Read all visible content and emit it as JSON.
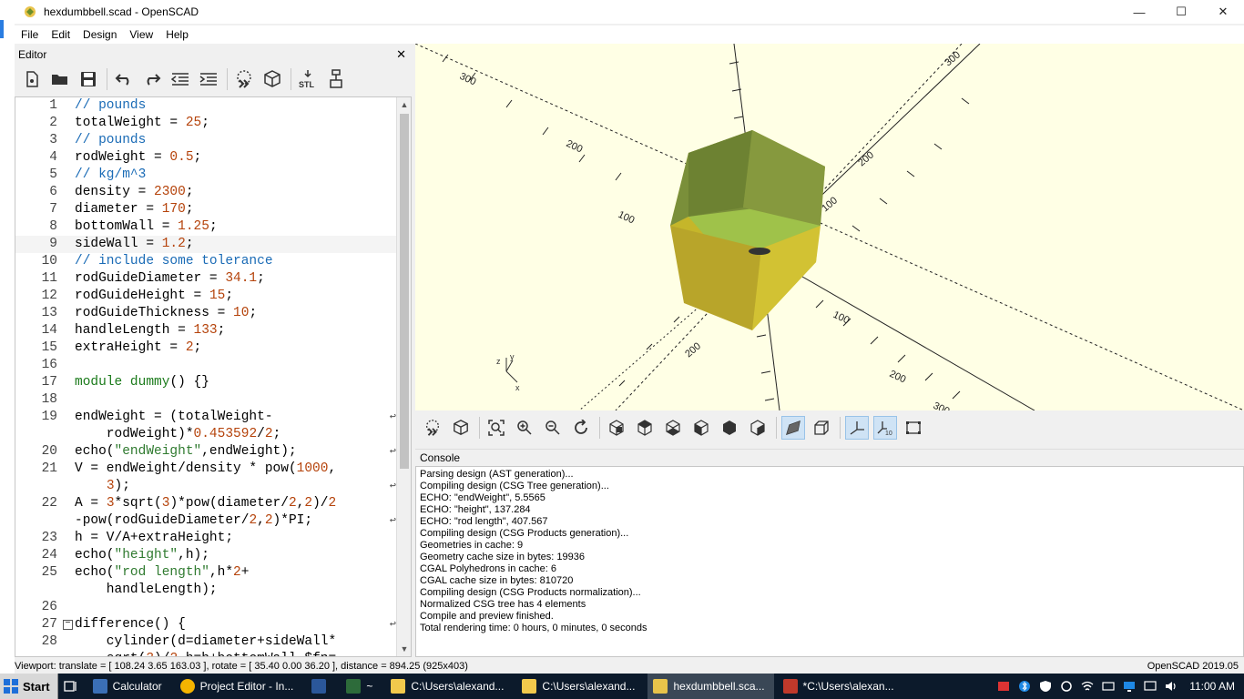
{
  "window": {
    "title": "hexdumbbell.scad - OpenSCAD",
    "controls": {
      "minimize": "—",
      "maximize": "☐",
      "close": "✕"
    }
  },
  "menu": [
    "File",
    "Edit",
    "Design",
    "View",
    "Help"
  ],
  "editor": {
    "title": "Editor",
    "close": "✕",
    "toolbar": [
      "new-icon",
      "open-icon",
      "save-icon",
      "undo-icon",
      "redo-icon",
      "unindent-icon",
      "indent-icon",
      "preview-icon",
      "render-icon",
      "export-stl-icon",
      "send-to-printer-icon"
    ],
    "lines": [
      {
        "n": "1",
        "text": "// pounds"
      },
      {
        "n": "2",
        "text": "totalWeight = 25;"
      },
      {
        "n": "3",
        "text": "// pounds"
      },
      {
        "n": "4",
        "text": "rodWeight = 0.5;"
      },
      {
        "n": "5",
        "text": "// kg/m^3"
      },
      {
        "n": "6",
        "text": "density = 2300;"
      },
      {
        "n": "7",
        "text": "diameter = 170;"
      },
      {
        "n": "8",
        "text": "bottomWall = 1.25;"
      },
      {
        "n": "9",
        "text": "sideWall = 1.2;"
      },
      {
        "n": "10",
        "text": "// include some tolerance"
      },
      {
        "n": "11",
        "text": "rodGuideDiameter = 34.1;"
      },
      {
        "n": "12",
        "text": "rodGuideHeight = 15;"
      },
      {
        "n": "13",
        "text": "rodGuideThickness = 10;"
      },
      {
        "n": "14",
        "text": "handleLength = 133;"
      },
      {
        "n": "15",
        "text": "extraHeight = 2;"
      },
      {
        "n": "16",
        "text": ""
      },
      {
        "n": "17",
        "text": "module dummy() {}"
      },
      {
        "n": "18",
        "text": ""
      },
      {
        "n": "19",
        "text": "endWeight = (totalWeight-"
      },
      {
        "n": "",
        "text": "    rodWeight)*0.453592/2;"
      },
      {
        "n": "20",
        "text": "echo(\"endWeight\",endWeight);"
      },
      {
        "n": "21",
        "text": "V = endWeight/density * pow(1000,"
      },
      {
        "n": "",
        "text": "    3);"
      },
      {
        "n": "22",
        "text": "A = 3*sqrt(3)*pow(diameter/2,2)/2"
      },
      {
        "n": "",
        "text": "-pow(rodGuideDiameter/2,2)*PI;"
      },
      {
        "n": "23",
        "text": "h = V/A+extraHeight;"
      },
      {
        "n": "24",
        "text": "echo(\"height\",h);"
      },
      {
        "n": "25",
        "text": "echo(\"rod length\",h*2+"
      },
      {
        "n": "",
        "text": "    handleLength);"
      },
      {
        "n": "26",
        "text": ""
      },
      {
        "n": "27",
        "text": "difference() {"
      },
      {
        "n": "28",
        "text": "    cylinder(d=diameter+sideWall*"
      },
      {
        "n": "",
        "text": "    sqrt(3)/2,h=h+bottomWall,$fn="
      }
    ]
  },
  "viewport": {
    "axis_ticks": [
      "300",
      "200",
      "100",
      "200",
      "100",
      "300",
      "200",
      "100",
      "200",
      "300"
    ],
    "colors": {
      "background": "#ffffe5",
      "shell_top": "#7a8f3a",
      "shell_side": "#c5b62a",
      "inner": "#9fc24a"
    }
  },
  "view_toolbar": [
    "preview-icon",
    "render-icon",
    "view-all-icon",
    "zoom-in-icon",
    "zoom-out-icon",
    "reset-view-icon",
    "view-right-icon",
    "view-top-icon",
    "view-bottom-icon",
    "view-left-icon",
    "view-front-icon",
    "view-back-icon",
    "perspective-icon",
    "orthogonal-icon",
    "show-axes-icon",
    "show-scale-markers-icon",
    "show-edges-icon"
  ],
  "console": {
    "title": "Console",
    "lines": [
      "Parsing design (AST generation)...",
      "Compiling design (CSG Tree generation)...",
      "ECHO: \"endWeight\", 5.5565",
      "ECHO: \"height\", 137.284",
      "ECHO: \"rod length\", 407.567",
      "Compiling design (CSG Products generation)...",
      "Geometries in cache: 9",
      "Geometry cache size in bytes: 19936",
      "CGAL Polyhedrons in cache: 6",
      "CGAL cache size in bytes: 810720",
      "Compiling design (CSG Products normalization)...",
      "Normalized CSG tree has 4 elements",
      "Compile and preview finished.",
      "Total rendering time: 0 hours, 0 minutes, 0 seconds"
    ]
  },
  "status": {
    "viewport": "Viewport: translate = [ 108.24 3.65 163.03 ], rotate = [ 35.40 0.00 36.20 ], distance = 894.25 (925x403)",
    "version": "OpenSCAD 2019.05"
  },
  "taskbar": {
    "start": "Start",
    "items": [
      {
        "label": "Calculator",
        "icon": "calculator-icon"
      },
      {
        "label": "Project Editor - In...",
        "icon": "chrome-icon"
      },
      {
        "label": "",
        "icon": "word-icon"
      },
      {
        "label": "~",
        "icon": "terminal-icon"
      },
      {
        "label": "C:\\Users\\alexand...",
        "icon": "folder-icon"
      },
      {
        "label": "C:\\Users\\alexand...",
        "icon": "folder-icon"
      },
      {
        "label": "hexdumbbell.sca...",
        "icon": "openscad-icon"
      },
      {
        "label": "*C:\\Users\\alexan...",
        "icon": "editor-icon"
      }
    ],
    "clock": "11:00 AM"
  }
}
